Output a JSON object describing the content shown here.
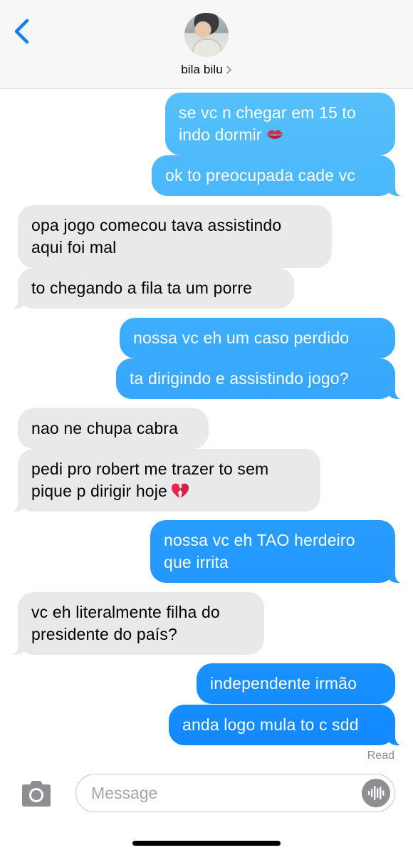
{
  "header": {
    "contact_name": "bila bilu"
  },
  "messages": [
    {
      "id": "m1",
      "dir": "out",
      "lines": [
        "se vc n chegar em 15 to",
        "indo dormir"
      ],
      "emoji": "kiss-icon"
    },
    {
      "id": "m2",
      "dir": "out",
      "lines": [
        "ok to preocupada cade vc"
      ]
    },
    {
      "id": "m3",
      "dir": "in",
      "lines": [
        "opa jogo comecou tava assistindo",
        "aqui foi mal"
      ]
    },
    {
      "id": "m4",
      "dir": "in",
      "lines": [
        "to chegando a fila ta um porre"
      ]
    },
    {
      "id": "m5",
      "dir": "out",
      "lines": [
        "nossa vc eh um caso perdido"
      ]
    },
    {
      "id": "m6",
      "dir": "out",
      "lines": [
        "ta dirigindo e assistindo jogo?"
      ]
    },
    {
      "id": "m7",
      "dir": "in",
      "lines": [
        "nao ne chupa cabra"
      ]
    },
    {
      "id": "m8",
      "dir": "in",
      "lines": [
        "pedi pro robert me trazer to sem",
        "pique p dirigir hoje"
      ],
      "emoji": "broken-heart-icon"
    },
    {
      "id": "m9",
      "dir": "out",
      "lines": [
        "nossa vc eh TAO herdeiro",
        "que irrita"
      ]
    },
    {
      "id": "m10",
      "dir": "in",
      "lines": [
        "vc eh literalmente filha do",
        "presidente do país?"
      ]
    },
    {
      "id": "m11",
      "dir": "out",
      "lines": [
        "independente irmão"
      ]
    },
    {
      "id": "m12",
      "dir": "out",
      "lines": [
        "anda logo mula to c sdd"
      ]
    }
  ],
  "status": {
    "read_label": "Read"
  },
  "composer": {
    "placeholder": "Message"
  },
  "colors": {
    "sent_bubble_top": "#5ac4fa",
    "sent_bubble_bottom": "#0a84ff",
    "received_bubble": "#e9e9eb",
    "accent": "#147efb"
  }
}
